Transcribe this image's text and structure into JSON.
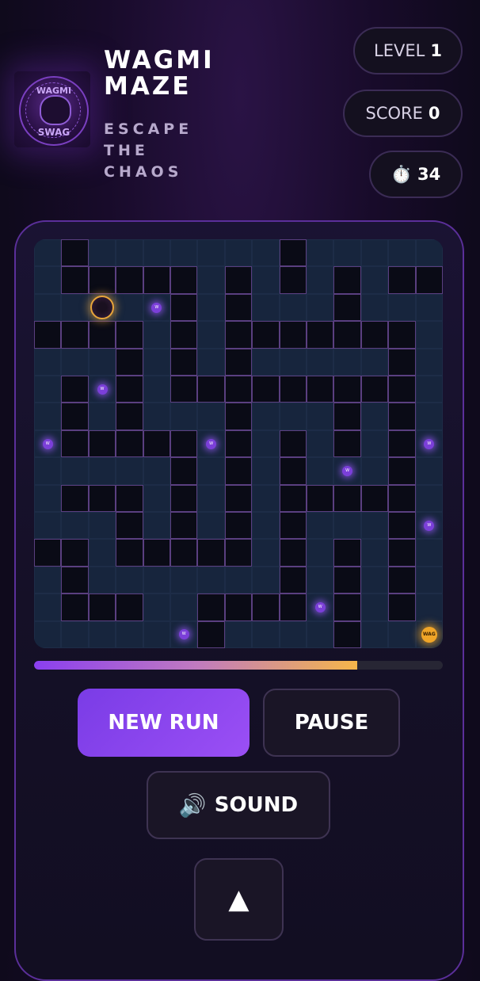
{
  "header": {
    "logo_text_top": "WAGMI",
    "logo_text_bottom": "SWAG",
    "title_line1": "WAGMI",
    "title_line2": "MAZE",
    "subtitle_line1": "ESCAPE",
    "subtitle_line2": "THE",
    "subtitle_line3": "CHAOS"
  },
  "stats": {
    "level_label": "LEVEL",
    "level_value": "1",
    "score_label": "SCORE",
    "score_value": "0",
    "timer_icon": "⏱️",
    "timer_value": "34"
  },
  "maze": {
    "rows": 15,
    "cols": 15,
    "grid": [
      "PWPPPPPPPWPPPPP",
      "PWWWWWPWPWPWPWW",
      "PPPPPWPWPPPWPPP",
      "WWWWPWPWWWWWWWP",
      "PPPWPWPWPPPPPWP",
      "PWPWPWWWWWWWWWP",
      "PWPWPPPWPPPWPWP",
      "PWWWWWPWPWPWPWP",
      "PPPPPWPWPWPPPWP",
      "PWWWPWPWPWWWWWP",
      "PPPWPWPWPWPPPWP",
      "WWPWWWWWPWPWPWP",
      "PWPPPPPPPWPWPWP",
      "PWWWPPWWWWPWPWP",
      "PPPPPPWPPPPWPPP"
    ],
    "coin_label": "W",
    "coins": [
      {
        "row": 2,
        "col": 4
      },
      {
        "row": 5,
        "col": 2
      },
      {
        "row": 7,
        "col": 0
      },
      {
        "row": 7,
        "col": 6
      },
      {
        "row": 7,
        "col": 14
      },
      {
        "row": 8,
        "col": 11
      },
      {
        "row": 10,
        "col": 14
      },
      {
        "row": 13,
        "col": 10
      },
      {
        "row": 14,
        "col": 5
      }
    ],
    "player": {
      "row": 2,
      "col": 2
    },
    "exit": {
      "row": 14,
      "col": 14
    },
    "exit_label": "WAG"
  },
  "progress": {
    "fraction": 0.79
  },
  "controls": {
    "new_run_label": "NEW RUN",
    "pause_label": "PAUSE",
    "sound_icon": "🔊",
    "sound_label": "SOUND",
    "up_icon": "▲"
  }
}
